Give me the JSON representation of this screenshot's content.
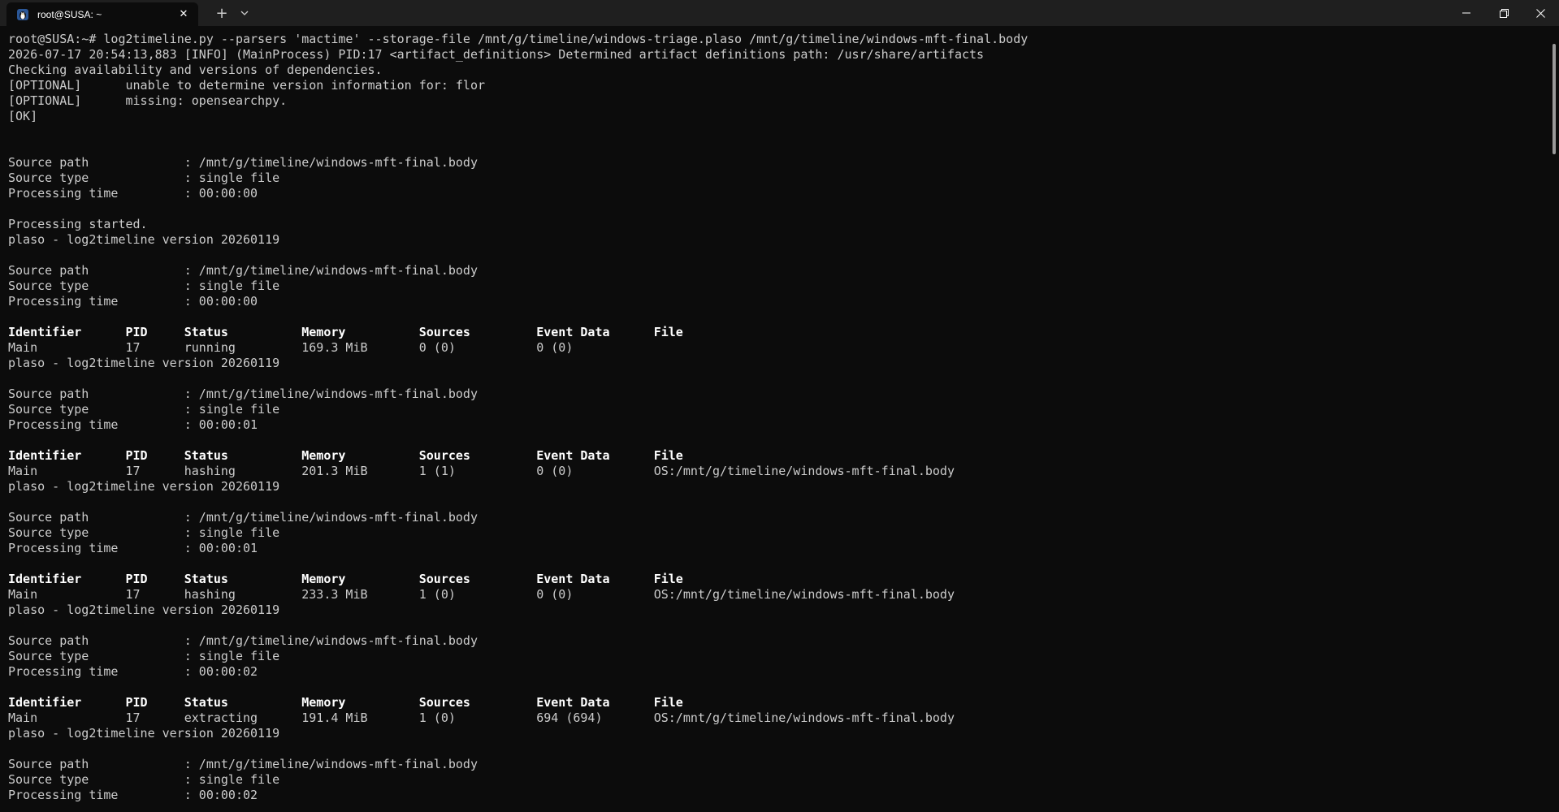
{
  "window": {
    "tab_title": "root@SUSA: ~",
    "tab_icon": "linux-penguin-icon",
    "new_tab_label": "+",
    "controls": [
      "minimize-icon",
      "maximize-icon",
      "close-icon"
    ]
  },
  "terminal": {
    "lines": [
      "root@SUSA:~# log2timeline.py --parsers 'mactime' --storage-file /mnt/g/timeline/windows-triage.plaso /mnt/g/timeline/windows-mft-final.body",
      "2026-07-17 20:54:13,883 [INFO] (MainProcess) PID:17 <artifact_definitions> Determined artifact definitions path: /usr/share/artifacts",
      "Checking availability and versions of dependencies.",
      "[OPTIONAL]      unable to determine version information for: flor",
      "[OPTIONAL]      missing: opensearchpy.",
      "[OK]",
      "",
      "",
      "Source path             : /mnt/g/timeline/windows-mft-final.body",
      "Source type             : single file",
      "Processing time         : 00:00:00",
      "",
      "Processing started.",
      "plaso - log2timeline version 20260119",
      "",
      "Source path             : /mnt/g/timeline/windows-mft-final.body",
      "Source type             : single file",
      "Processing time         : 00:00:00",
      "",
      "Identifier      PID     Status          Memory          Sources         Event Data      File",
      "Main            17      running         169.3 MiB       0 (0)           0 (0)",
      "plaso - log2timeline version 20260119",
      "",
      "Source path             : /mnt/g/timeline/windows-mft-final.body",
      "Source type             : single file",
      "Processing time         : 00:00:01",
      "",
      "Identifier      PID     Status          Memory          Sources         Event Data      File",
      "Main            17      hashing         201.3 MiB       1 (1)           0 (0)           OS:/mnt/g/timeline/windows-mft-final.body",
      "plaso - log2timeline version 20260119",
      "",
      "Source path             : /mnt/g/timeline/windows-mft-final.body",
      "Source type             : single file",
      "Processing time         : 00:00:01",
      "",
      "Identifier      PID     Status          Memory          Sources         Event Data      File",
      "Main            17      hashing         233.3 MiB       1 (0)           0 (0)           OS:/mnt/g/timeline/windows-mft-final.body",
      "plaso - log2timeline version 20260119",
      "",
      "Source path             : /mnt/g/timeline/windows-mft-final.body",
      "Source type             : single file",
      "Processing time         : 00:00:02",
      "",
      "Identifier      PID     Status          Memory          Sources         Event Data      File",
      "Main            17      extracting      191.4 MiB       1 (0)           694 (694)       OS:/mnt/g/timeline/windows-mft-final.body",
      "plaso - log2timeline version 20260119",
      "",
      "Source path             : /mnt/g/timeline/windows-mft-final.body",
      "Source type             : single file",
      "Processing time         : 00:00:02"
    ]
  }
}
